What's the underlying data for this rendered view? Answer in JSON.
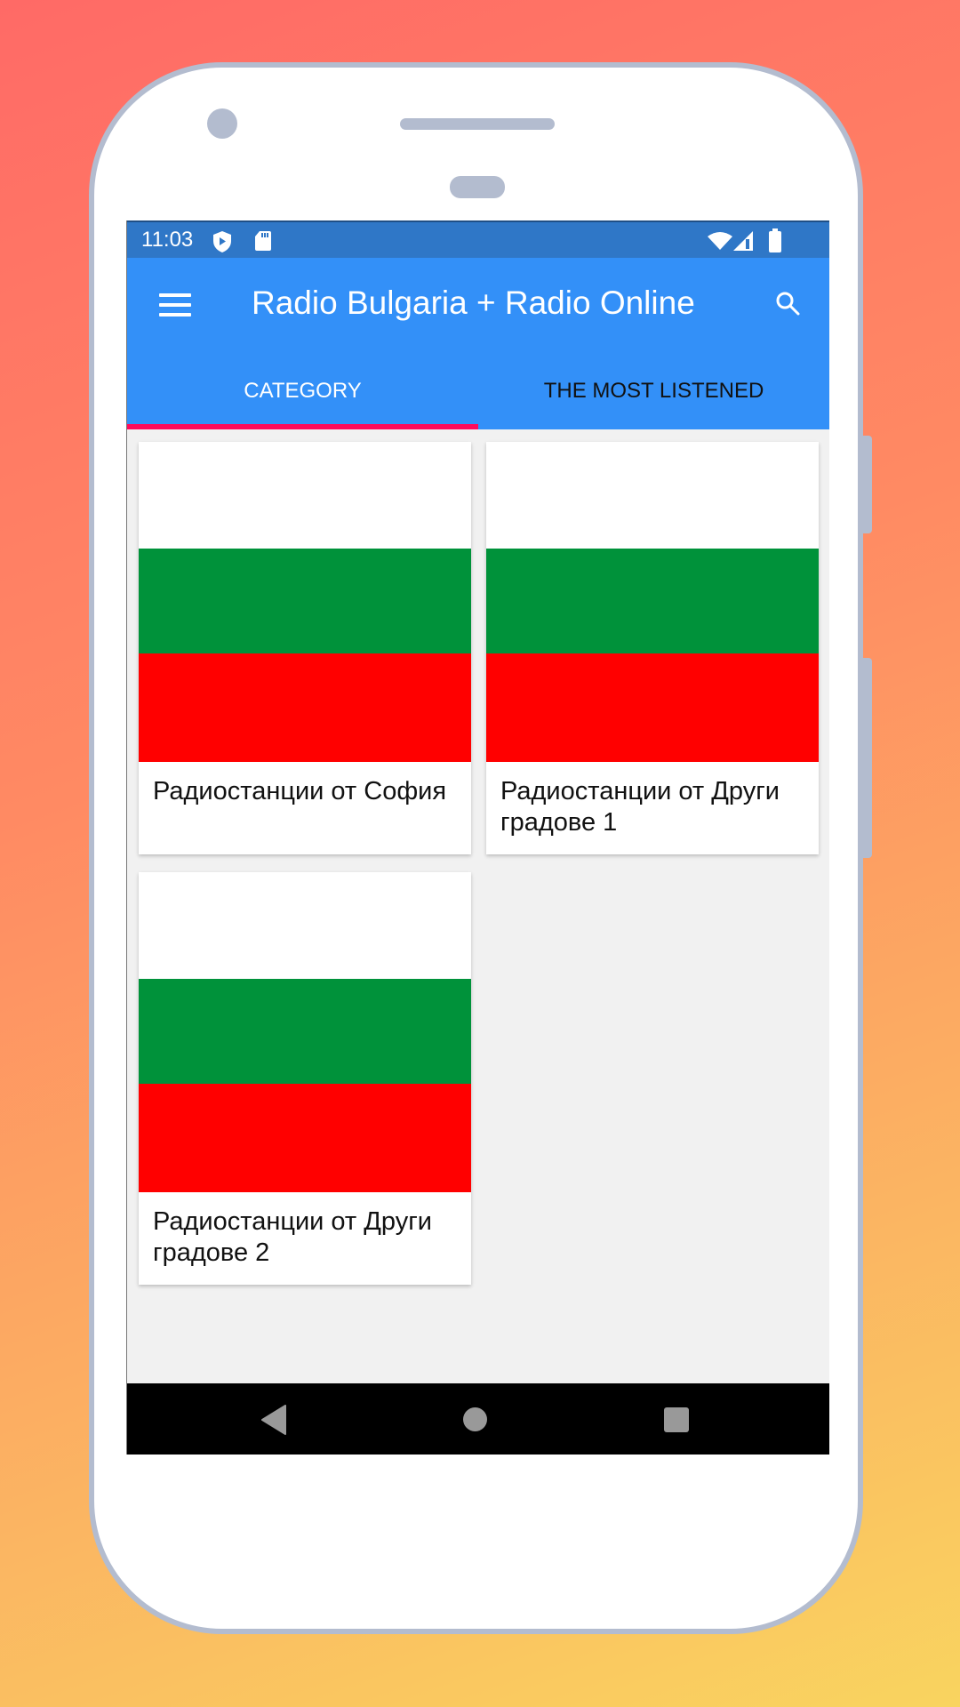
{
  "status_bar": {
    "time": "11:03",
    "left_icons": [
      "play-protect-icon",
      "sd-card-icon"
    ],
    "right_icons": [
      "wifi-icon",
      "signal-icon",
      "battery-icon"
    ]
  },
  "app_bar": {
    "title": "Radio Bulgaria + Radio Online",
    "menu_icon": "hamburger-menu-icon",
    "search_icon": "search-icon"
  },
  "tabs": [
    {
      "label": "CATEGORY",
      "selected": true
    },
    {
      "label": "THE MOST LISTENED",
      "selected": false
    }
  ],
  "colors": {
    "status_bar": "#2f77c7",
    "app_bar": "#3390f8",
    "tab_indicator": "#ff0a5c",
    "flag_white": "#ffffff",
    "flag_green": "#00923a",
    "flag_red": "#ff0000"
  },
  "categories": [
    {
      "label": "Радиостанции от София",
      "image": "bulgarian-flag"
    },
    {
      "label": "Радиостанции от Други градове 1",
      "image": "bulgarian-flag"
    },
    {
      "label": "Радиостанции от Други градове 2",
      "image": "bulgarian-flag"
    }
  ],
  "nav_bar": {
    "buttons": [
      "back",
      "home",
      "recents"
    ]
  }
}
